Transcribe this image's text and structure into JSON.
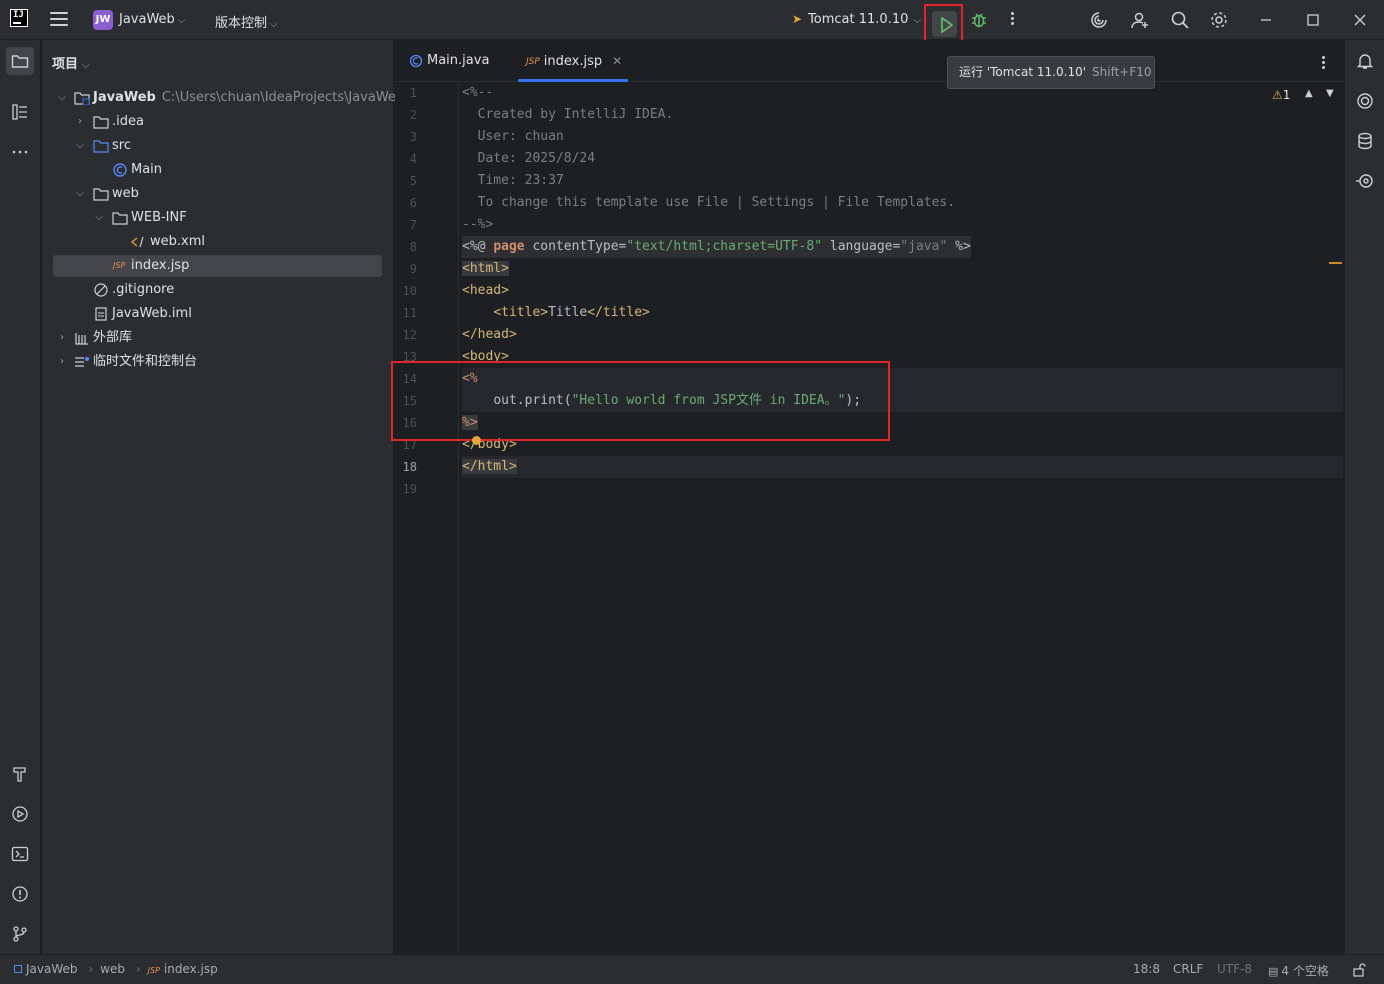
{
  "titlebar": {
    "project_badge": "JW",
    "project_name": "JavaWeb",
    "vcs_label": "版本控制",
    "run_config": "Tomcat 11.0.10"
  },
  "tooltip": {
    "text": "运行 'Tomcat 11.0.10'",
    "shortcut": "Shift+F10"
  },
  "project_panel": {
    "title": "项目",
    "tree": [
      {
        "label": "JavaWeb",
        "path": "C:\\Users\\chuan\\IdeaProjects\\JavaWeb"
      },
      {
        "label": ".idea"
      },
      {
        "label": "src"
      },
      {
        "label": "Main"
      },
      {
        "label": "web"
      },
      {
        "label": "WEB-INF"
      },
      {
        "label": "web.xml"
      },
      {
        "label": "index.jsp"
      },
      {
        "label": ".gitignore"
      },
      {
        "label": "JavaWeb.iml"
      },
      {
        "label": "外部库"
      },
      {
        "label": "临时文件和控制台"
      }
    ]
  },
  "editor": {
    "tabs": [
      {
        "label": "Main.java"
      },
      {
        "label": "index.jsp"
      }
    ],
    "jsp_badge": "JSP",
    "warning_count": "1",
    "line_numbers": [
      "1",
      "2",
      "3",
      "4",
      "5",
      "6",
      "7",
      "8",
      "9",
      "10",
      "11",
      "12",
      "13",
      "14",
      "15",
      "16",
      "17",
      "18",
      "19"
    ],
    "code": {
      "l1": "<%--",
      "l2": "  Created by IntelliJ IDEA.",
      "l3": "  User: chuan",
      "l4": "  Date: 2025/8/24",
      "l5": "  Time: 23:37",
      "l6": "  To change this template use File | Settings | File Templates.",
      "l7": "--%>",
      "l8_open": "<%@ ",
      "l8_kw": "page",
      "l8_a1": " contentType=",
      "l8_v1": "\"text/html;charset=UTF-8\"",
      "l8_a2": " language=",
      "l8_v2": "\"java\"",
      "l8_close": " %>",
      "l9": "<html>",
      "l10": "<head>",
      "l11_indent": "    ",
      "l11_open": "<title>",
      "l11_text": "Title",
      "l11_close": "</title>",
      "l12": "</head>",
      "l13": "<body>",
      "l14": "<%",
      "l15_indent": "    ",
      "l15_call": "out.print(",
      "l15_str": "\"Hello world from JSP文件 in IDEA。\"",
      "l15_end": ");",
      "l16": "%>",
      "l17": "</body>",
      "l18": "</html>"
    }
  },
  "statusbar": {
    "breadcrumb": [
      "JavaWeb",
      "web",
      "index.jsp"
    ],
    "position": "18:8",
    "line_sep": "CRLF",
    "encoding": "UTF-8",
    "indent": "4 个空格"
  },
  "colors": {
    "accent": "#3574f0",
    "highlight_box": "#e0262a",
    "run_green": "#5fb865"
  }
}
